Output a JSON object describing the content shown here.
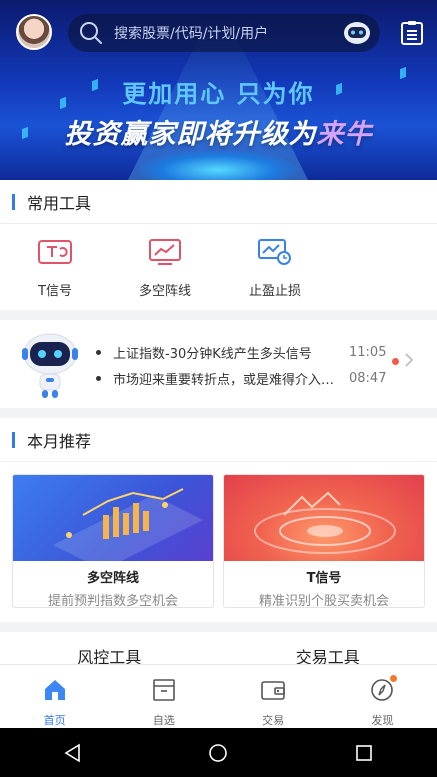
{
  "header": {
    "search_placeholder": "搜索股票/代码/计划/用户"
  },
  "banner": {
    "line1": "更加用心  只为你",
    "line2_prefix": "投资赢家即将升级为",
    "line2_accent": "来牛"
  },
  "tools_section": {
    "title": "常用工具",
    "items": [
      {
        "label": "T信号",
        "icon": "t-signal-icon"
      },
      {
        "label": "多空阵线",
        "icon": "trend-chart-icon"
      },
      {
        "label": "止盈止损",
        "icon": "stop-profit-loss-icon"
      }
    ]
  },
  "signals": [
    {
      "text": "上证指数-30分钟K线产生多头信号",
      "time": "11:05"
    },
    {
      "text": "市场迎来重要转折点，或是难得介入良机",
      "time": "08:47"
    }
  ],
  "recommend_section": {
    "title": "本月推荐",
    "cards": [
      {
        "title": "多空阵线",
        "subtitle": "提前预判指数多空机会"
      },
      {
        "title": "T信号",
        "subtitle": "精准识别个股买卖机会"
      }
    ]
  },
  "next_section": {
    "left": "风控工具",
    "right": "交易工具"
  },
  "tabbar": [
    {
      "label": "首页",
      "icon": "home-icon",
      "active": true
    },
    {
      "label": "自选",
      "icon": "watchlist-icon",
      "active": false
    },
    {
      "label": "交易",
      "icon": "wallet-icon",
      "active": false
    },
    {
      "label": "发现",
      "icon": "compass-icon",
      "active": false,
      "badge": true
    }
  ],
  "colors": {
    "accent": "#2f7bf0",
    "alert": "#f05a46"
  }
}
